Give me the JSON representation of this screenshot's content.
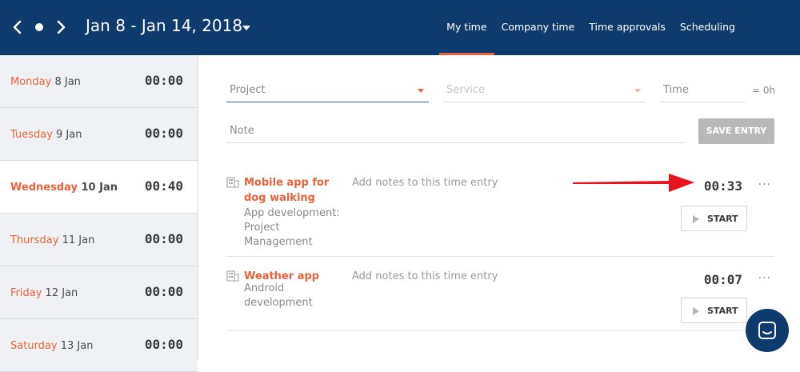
{
  "header": {
    "date_range": "Jan 8 - Jan 14, 2018",
    "tabs": [
      {
        "label": "My time",
        "active": true
      },
      {
        "label": "Company time",
        "active": false
      },
      {
        "label": "Time approvals",
        "active": false
      },
      {
        "label": "Scheduling",
        "active": false
      }
    ]
  },
  "days": [
    {
      "name": "Monday",
      "date": "8 Jan",
      "total": "00:00",
      "active": false
    },
    {
      "name": "Tuesday",
      "date": "9 Jan",
      "total": "00:00",
      "active": false
    },
    {
      "name": "Wednesday",
      "date": "10 Jan",
      "total": "00:40",
      "active": true
    },
    {
      "name": "Thursday",
      "date": "11 Jan",
      "total": "00:00",
      "active": false
    },
    {
      "name": "Friday",
      "date": "12 Jan",
      "total": "00:00",
      "active": false
    },
    {
      "name": "Saturday",
      "date": "13 Jan",
      "total": "00:00",
      "active": false
    }
  ],
  "form": {
    "project_placeholder": "Project",
    "service_placeholder": "Service",
    "time_placeholder": "Time",
    "time_total": "= 0h",
    "note_placeholder": "Note",
    "save_label": "SAVE ENTRY"
  },
  "entries": [
    {
      "project": "Mobile app for dog walking",
      "service": "App development: Project Management",
      "notes_placeholder": "Add notes to this time entry",
      "duration": "00:33",
      "more": "···",
      "start_label": "START"
    },
    {
      "project": "Weather app",
      "service": "Android development",
      "notes_placeholder": "Add notes to this time entry",
      "duration": "00:07",
      "more": "···",
      "start_label": "START"
    }
  ],
  "colors": {
    "header_bg": "#0d3b6e",
    "accent": "#e8623a",
    "annotation_arrow": "#e8141d"
  }
}
